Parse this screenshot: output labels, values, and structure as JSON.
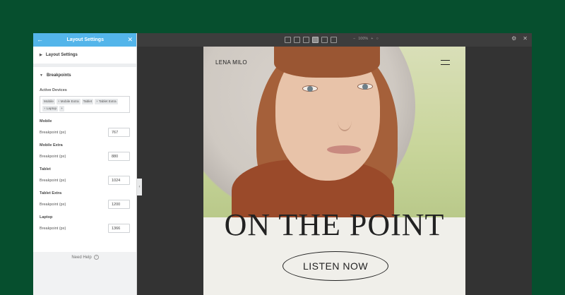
{
  "panel": {
    "title": "Layout Settings",
    "back_icon": "arrow-left-icon",
    "close_icon": "close-icon",
    "section_layout": "Layout Settings",
    "section_breakpoints": "Breakpoints",
    "active_devices_label": "Active Devices",
    "devices": [
      "Mobile",
      "Mobile Extra",
      "Tablet",
      "Tablet Extra",
      "Laptop"
    ],
    "add_device": "+",
    "breakpoint_field_label": "Breakpoint (px)",
    "breakpoints": [
      {
        "name": "Mobile",
        "value": "767"
      },
      {
        "name": "Mobile Extra",
        "value": "880"
      },
      {
        "name": "Tablet",
        "value": "1024"
      },
      {
        "name": "Tablet Extra",
        "value": "1200"
      },
      {
        "name": "Laptop",
        "value": "1366"
      }
    ],
    "need_help": "Need Help",
    "help_icon": "?"
  },
  "toolbar": {
    "zoom": "100%",
    "zoom_out": "−",
    "zoom_reset": "○",
    "settings_icon": "⚙",
    "close_icon": "✕",
    "accent": "#53b5ea"
  },
  "preview": {
    "brand": "LENA MILO",
    "headline": "ON THE POINT",
    "cta": "LISTEN NOW"
  }
}
